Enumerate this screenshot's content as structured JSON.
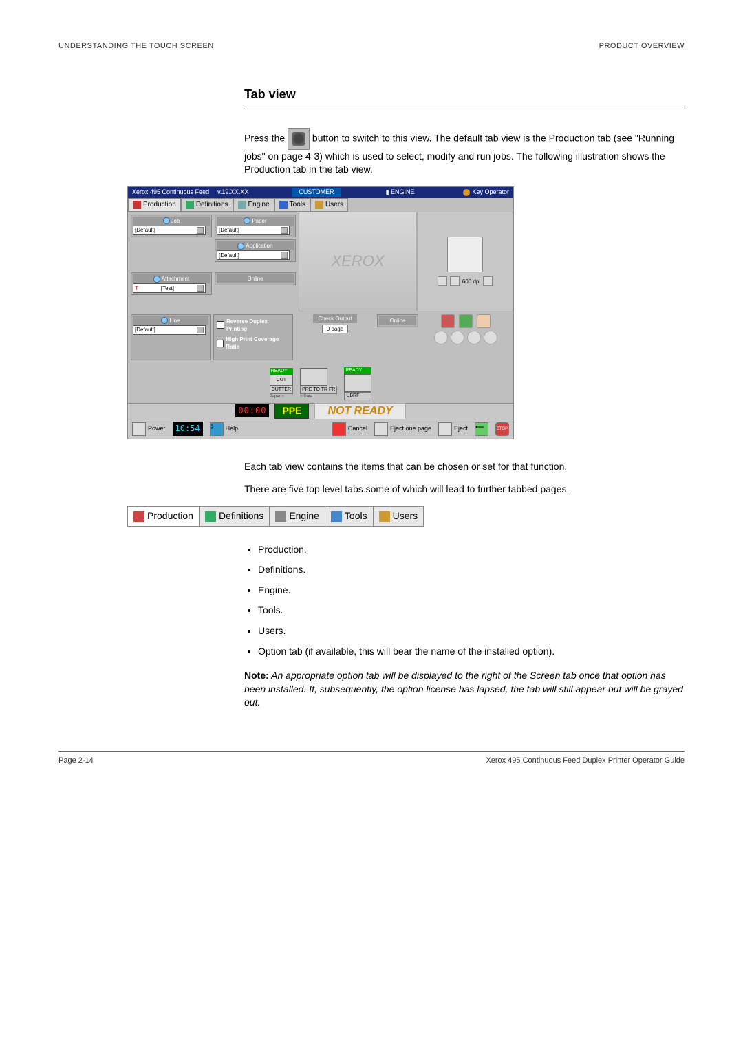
{
  "header": {
    "left": "UNDERSTANDING THE TOUCH SCREEN",
    "right": "PRODUCT OVERVIEW"
  },
  "section_title": "Tab view",
  "para1a": "Press the ",
  "para1b": " button to switch to this view. The default tab view is the Production tab (see \"Running jobs\" on page 4-3) which is used to select, modify and run jobs. The following illustration shows the Production tab in the tab view.",
  "screenshot": {
    "titlebar": {
      "product": "Xerox  495 Continuous Feed",
      "version": "v.19.XX.XX",
      "customer": "CUSTOMER",
      "engine": "ENGINE",
      "keyop": "Key Operator"
    },
    "tabs": [
      "Production",
      "Definitions",
      "Engine",
      "Tools",
      "Users"
    ],
    "job_label": "Job",
    "job_val": "[Default]",
    "paper_label": "Paper",
    "paper_val": "[Default]",
    "app_label": "Application",
    "app_val": "[Default]",
    "att_label": "Attachment",
    "att_val": "[Test]",
    "online_label": "Online",
    "line_label": "Line",
    "line_val": "[Default]",
    "reverse": "Reverse Duplex Printing",
    "highprint": "High Print Coverage Ratio",
    "check_output": "Check Output",
    "check_pages": "0 page",
    "online2": "Online",
    "dpi": "600 dpi",
    "brand": "XEROX",
    "diagram": {
      "ready1": "READY",
      "cut": "CUT",
      "cutter": "CUTTER",
      "paper": "Paper",
      "pretofr": "PRE TO  TR  FR",
      "data": "Data",
      "ubrf": "UBRF",
      "ready2": "READY"
    },
    "status": {
      "digits": "00:00",
      "ppe": "PPE",
      "notready": "NOT READY"
    },
    "bottom": {
      "power": "Power",
      "time": "10:54",
      "help": "Help",
      "cancel": "Cancel",
      "ejectone": "Eject one page",
      "eject": "Eject",
      "stop": "STOP"
    }
  },
  "para2": "Each tab view contains the items that can be chosen or set for that function.",
  "para3": "There are five top level tabs some of which will lead to further tabbed pages.",
  "tab_strip": [
    "Production",
    "Definitions",
    "Engine",
    "Tools",
    "Users"
  ],
  "tab_list": [
    "Production.",
    "Definitions.",
    "Engine.",
    "Tools.",
    "Users.",
    "Option tab (if available, this will bear the name of the installed option)."
  ],
  "note_bold": "Note:",
  "note_text": " An appropriate option tab will be displayed to the right of the Screen tab once that option has been installed. If, subsequently, the option license has lapsed, the tab will still appear but will be grayed out.",
  "footer": {
    "left": "Page 2-14",
    "right": "Xerox 495 Continuous Feed Duplex Printer Operator Guide"
  }
}
